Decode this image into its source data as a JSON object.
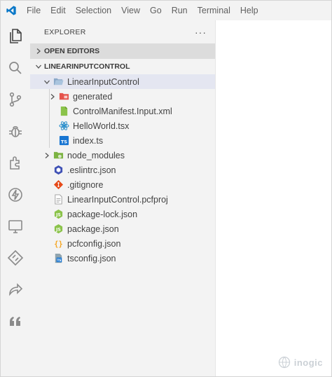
{
  "menu": [
    "File",
    "Edit",
    "Selection",
    "View",
    "Go",
    "Run",
    "Terminal",
    "Help"
  ],
  "sidebar": {
    "title": "EXPLORER",
    "more": "···",
    "sections": {
      "open_editors": "OPEN EDITORS",
      "project": "LINEARINPUTCONTROL"
    },
    "tree": [
      {
        "label": "LinearInputControl",
        "icon": "folder-open-icon"
      },
      {
        "label": "generated",
        "icon": "folder-generated-icon"
      },
      {
        "label": "ControlManifest.Input.xml",
        "icon": "xml-file-icon"
      },
      {
        "label": "HelloWorld.tsx",
        "icon": "react-file-icon"
      },
      {
        "label": "index.ts",
        "icon": "typescript-file-icon"
      },
      {
        "label": "node_modules",
        "icon": "folder-node-icon"
      },
      {
        "label": ".eslintrc.json",
        "icon": "eslint-file-icon"
      },
      {
        "label": ".gitignore",
        "icon": "git-file-icon"
      },
      {
        "label": "LinearInputControl.pcfproj",
        "icon": "project-file-icon"
      },
      {
        "label": "package-lock.json",
        "icon": "node-file-icon"
      },
      {
        "label": "package.json",
        "icon": "node-file-icon"
      },
      {
        "label": "pcfconfig.json",
        "icon": "json-file-icon"
      },
      {
        "label": "tsconfig.json",
        "icon": "tsconfig-file-icon"
      }
    ]
  },
  "watermark": {
    "text": "inogic"
  },
  "colors": {
    "accent": "#007acc",
    "sidebar_bg": "#f3f3f3",
    "selected_row": "#e4e6f1"
  }
}
